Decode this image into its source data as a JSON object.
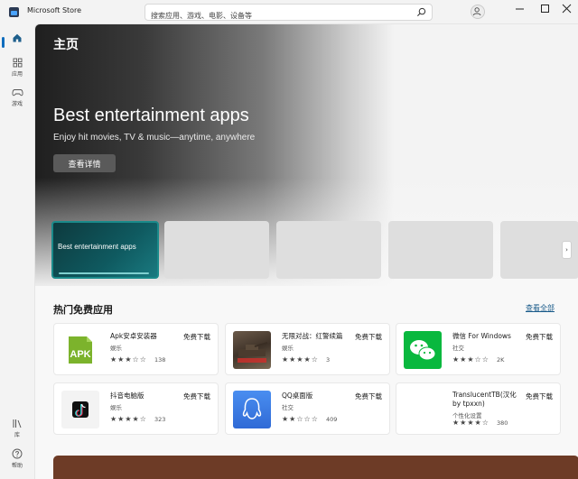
{
  "window": {
    "title": "Microsoft Store"
  },
  "search": {
    "placeholder": "搜索应用、游戏、电影、设备等"
  },
  "nav": {
    "items": [
      {
        "label": ""
      },
      {
        "label": "应用"
      },
      {
        "label": "游戏"
      },
      {
        "label": "库"
      },
      {
        "label": "帮助"
      }
    ]
  },
  "hero": {
    "page_title": "主页",
    "title": "Best entertainment apps",
    "subtitle": "Enjoy hit movies, TV & music—anytime, anywhere",
    "button_label": "查看详情"
  },
  "carousel": {
    "active_title": "Best entertainment apps"
  },
  "section": {
    "title": "热门免费应用",
    "see_all": "查看全部"
  },
  "apps": [
    {
      "name": "Apk安卓安装器",
      "category": "娱乐",
      "price": "免费下载",
      "rating_count": "138",
      "stars": "★★★☆☆",
      "icon": "apk-icon",
      "icon_label": "APK"
    },
    {
      "name": "无限对战：红警续篇",
      "category": "娱乐",
      "price": "免费下载",
      "rating_count": "3",
      "stars": "★★★★☆",
      "icon": "game-icon"
    },
    {
      "name": "微信 For Windows",
      "category": "社交",
      "price": "免费下载",
      "rating_count": "2K",
      "stars": "★★★☆☆",
      "icon": "wechat-icon"
    },
    {
      "name": "抖音电脑版",
      "category": "娱乐",
      "price": "免费下载",
      "rating_count": "323",
      "stars": "★★★★☆",
      "icon": "douyin-icon"
    },
    {
      "name": "QQ桌面版",
      "category": "社交",
      "price": "免费下载",
      "rating_count": "409",
      "stars": "★★☆☆☆",
      "icon": "qq-icon"
    },
    {
      "name": "TranslucentTB(汉化 by tpxxn)",
      "category": "个性化设置",
      "price": "免费下载",
      "rating_count": "380",
      "stars": "★★★★☆",
      "icon": "translucenttb-icon"
    }
  ],
  "colors": {
    "accent": "#0f6cbd",
    "link": "#1a5b8a",
    "carousel_active": "#0f5a60",
    "apk_green": "#7cb32c",
    "wechat_green": "#09b83e",
    "qq_blue": "#3a7be0"
  }
}
